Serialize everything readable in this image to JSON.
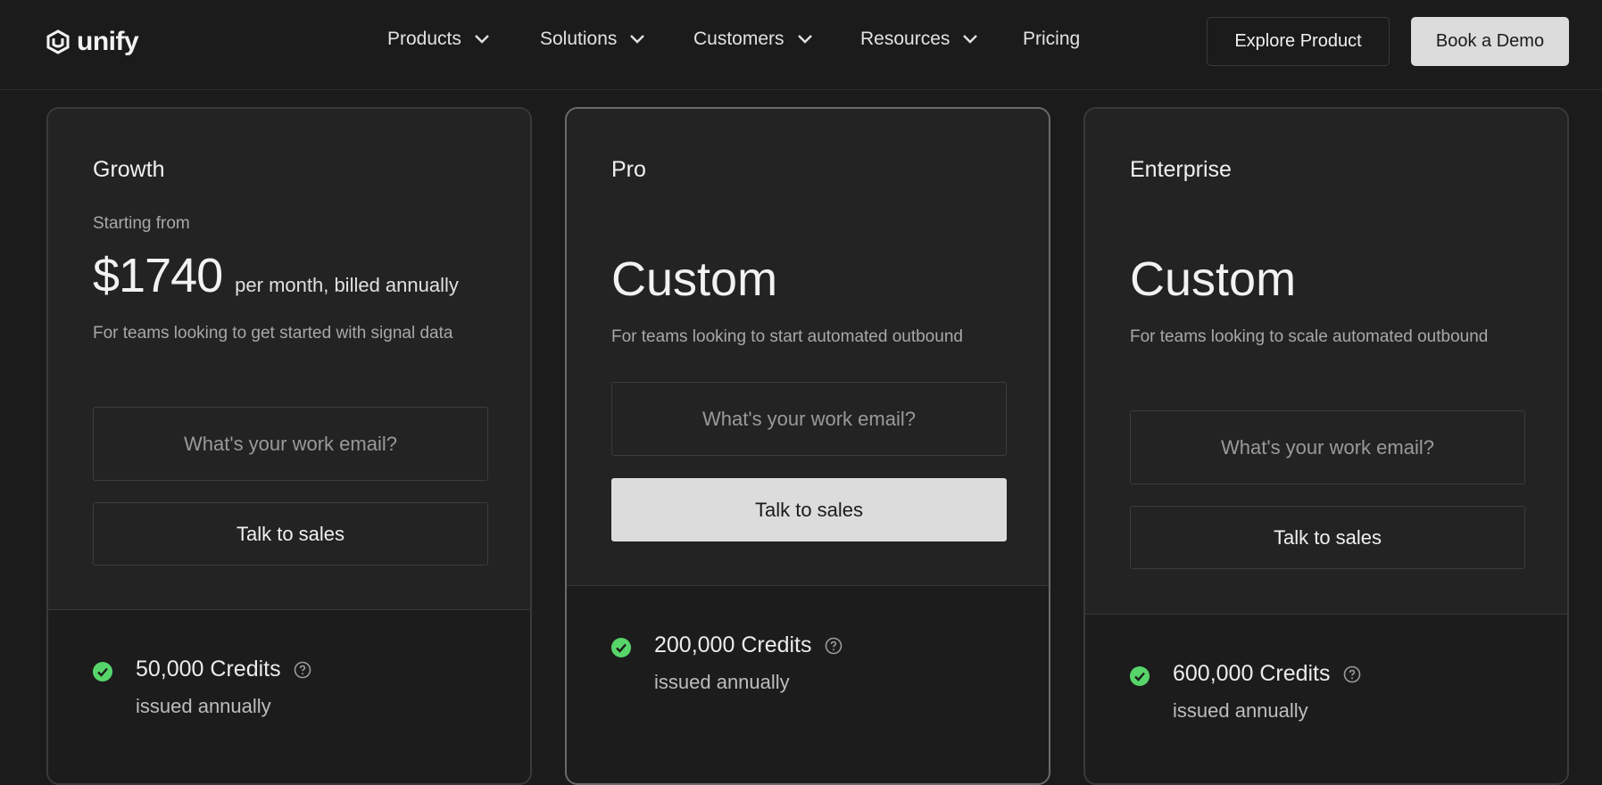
{
  "brand": {
    "name": "unify"
  },
  "nav": {
    "items": [
      {
        "label": "Products"
      },
      {
        "label": "Solutions"
      },
      {
        "label": "Customers"
      },
      {
        "label": "Resources"
      },
      {
        "label": "Pricing"
      }
    ],
    "explore_label": "Explore Product",
    "demo_label": "Book a Demo"
  },
  "email_placeholder": "What's your work email?",
  "plans": [
    {
      "name": "Growth",
      "starting_label": "Starting from",
      "price": "$1740",
      "price_period": "per month, billed annually",
      "description": "For teams looking to get started with signal data",
      "cta": "Talk to sales",
      "feature": {
        "title": "50,000 Credits",
        "subtitle": "issued annually"
      }
    },
    {
      "name": "Pro",
      "price": "Custom",
      "description": "For teams looking to start automated outbound",
      "cta": "Talk to sales",
      "feature": {
        "title": "200,000 Credits",
        "subtitle": "issued annually"
      }
    },
    {
      "name": "Enterprise",
      "price": "Custom",
      "description": "For teams looking to scale automated outbound",
      "cta": "Talk to sales",
      "feature": {
        "title": "600,000 Credits",
        "subtitle": "issued annually"
      }
    }
  ],
  "colors": {
    "background": "#1b1b1b",
    "card": "#232323",
    "check": "#57d56a",
    "primary_button": "#dcdcdc"
  },
  "icons": [
    "unify-logo-icon",
    "chevron-down-icon",
    "check-circle-icon",
    "question-circle-icon"
  ]
}
